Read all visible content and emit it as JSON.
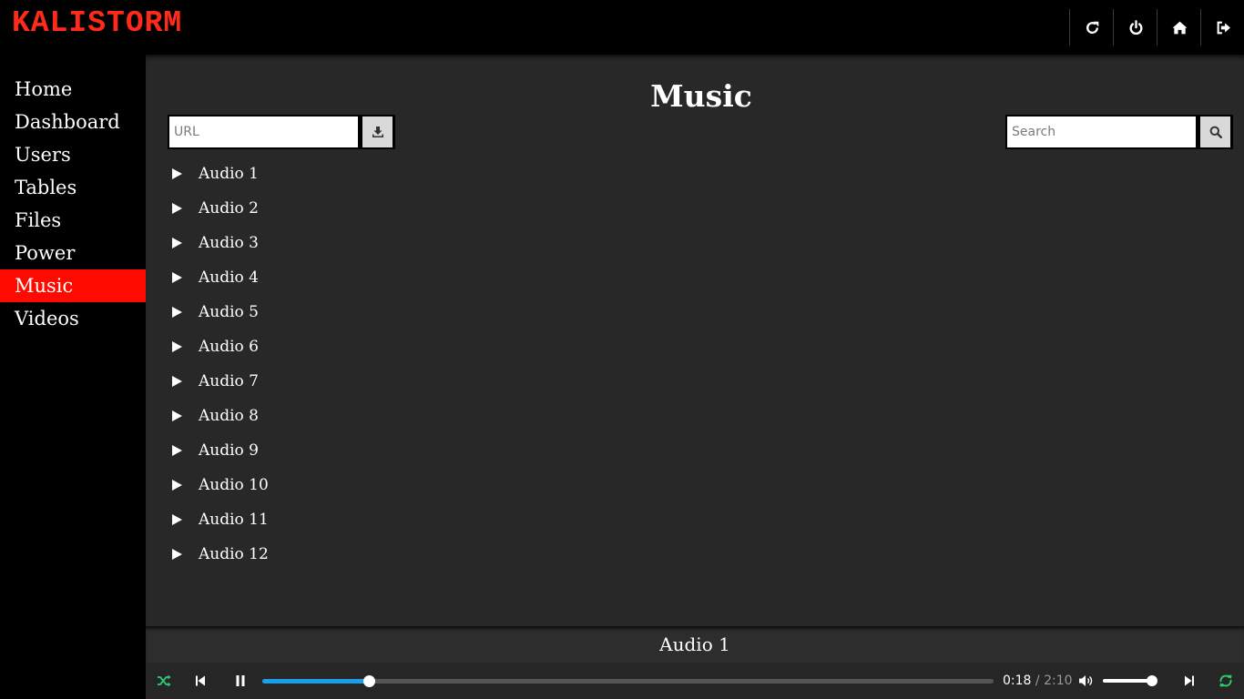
{
  "app": {
    "logo": "KALISTORM"
  },
  "header_buttons": [
    {
      "name": "refresh-button",
      "icon": "refresh-icon"
    },
    {
      "name": "power-button",
      "icon": "power-icon"
    },
    {
      "name": "home-button",
      "icon": "home-icon"
    },
    {
      "name": "logout-button",
      "icon": "logout-icon"
    }
  ],
  "sidebar": {
    "items": [
      {
        "label": "Home",
        "active": false
      },
      {
        "label": "Dashboard",
        "active": false
      },
      {
        "label": "Users",
        "active": false
      },
      {
        "label": "Tables",
        "active": false
      },
      {
        "label": "Files",
        "active": false
      },
      {
        "label": "Power",
        "active": false
      },
      {
        "label": "Music",
        "active": true
      },
      {
        "label": "Videos",
        "active": false
      }
    ]
  },
  "main": {
    "title": "Music",
    "url_input": {
      "placeholder": "URL",
      "value": "",
      "button_icon": "download-icon"
    },
    "search_input": {
      "placeholder": "Search",
      "value": "",
      "button_icon": "search-icon"
    },
    "tracks": [
      "Audio 1",
      "Audio 2",
      "Audio 3",
      "Audio 4",
      "Audio 5",
      "Audio 6",
      "Audio 7",
      "Audio 8",
      "Audio 9",
      "Audio 10",
      "Audio 11",
      "Audio 12"
    ]
  },
  "player": {
    "now_playing": "Audio 1",
    "current_time": "0:18",
    "separator": " / ",
    "duration": "2:10",
    "progress_fraction": 0.146,
    "volume_fraction": 1.0,
    "shuffle_on": true,
    "repeat_on": true
  },
  "colors": {
    "accent": "#ff0a00",
    "logo": "#ff2a1a",
    "progress": "#1aa0e8",
    "toggle_on": "#2ecc71"
  }
}
